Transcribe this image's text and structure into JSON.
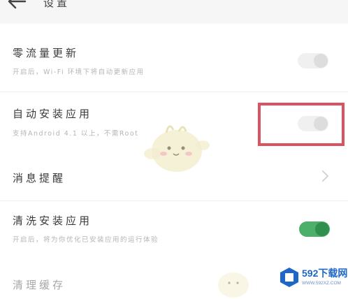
{
  "header": {
    "title": "设置"
  },
  "settings": [
    {
      "title": "零流量更新",
      "desc": "开启后，Wi-Fi 环境下将自动更新应用",
      "control": "toggle",
      "state": "off"
    },
    {
      "title": "自动安装应用",
      "desc": "支持Android 4.1 以上，不需Root",
      "control": "toggle",
      "state": "off"
    },
    {
      "title": "消息提醒",
      "control": "chevron"
    },
    {
      "title": "清洗安装应用",
      "desc": "开启后，将为你优化已安装应用的运行体验",
      "control": "toggle",
      "state": "on"
    },
    {
      "title": "清理缓存"
    }
  ],
  "watermark": {
    "name": "592下载网",
    "url": "WWW.592XZ.COM"
  },
  "colors": {
    "highlight": "#d9545e",
    "toggle_on": "#4caf6a",
    "toggle_off": "#f0f0f0",
    "brand": "#1f66c9"
  }
}
